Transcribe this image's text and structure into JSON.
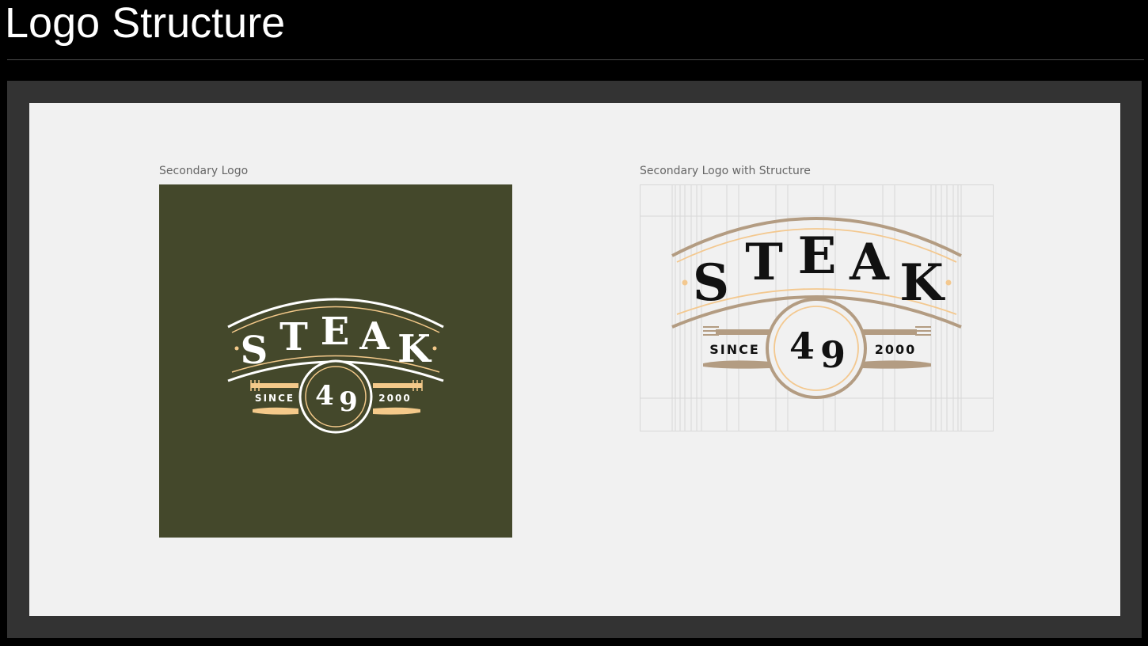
{
  "page": {
    "title": "Logo Structure"
  },
  "panels": {
    "left": {
      "caption": "Secondary Logo",
      "background": "#44482b"
    },
    "right": {
      "caption": "Secondary Logo with Structure"
    }
  },
  "logo": {
    "word": "STEAK",
    "letters": [
      "S",
      "T",
      "E",
      "A",
      "K"
    ],
    "number": "49",
    "number_digits": [
      "4",
      "9"
    ],
    "since_label": "SINCE",
    "year": "2000",
    "colors": {
      "cream": "#f4c98a",
      "white": "#ffffff",
      "tan": "#b39c82",
      "gold": "#f3c88f",
      "black": "#111111"
    },
    "icons": [
      "fork-icon",
      "knife-icon"
    ]
  }
}
